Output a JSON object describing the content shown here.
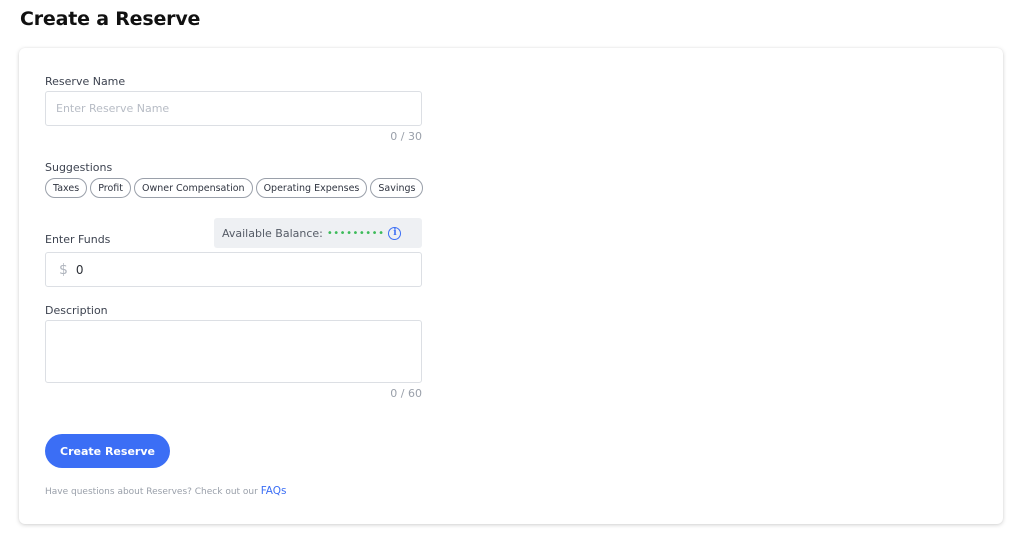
{
  "page": {
    "title": "Create a Reserve"
  },
  "form": {
    "reserve_name": {
      "label": "Reserve Name",
      "placeholder": "Enter Reserve Name",
      "value": "",
      "counter": "0 / 30"
    },
    "suggestions": {
      "label": "Suggestions",
      "items": [
        "Taxes",
        "Profit",
        "Owner Compensation",
        "Operating Expenses",
        "Savings"
      ]
    },
    "funds": {
      "label": "Enter Funds",
      "currency_symbol": "$",
      "value": "0",
      "available_balance_label": "Available Balance:",
      "available_balance_value": "•••••••••",
      "available_balance_color": "#3dbb5a",
      "info_icon": "info-icon"
    },
    "description": {
      "label": "Description",
      "value": "",
      "counter": "0 / 60"
    },
    "submit_label": "Create Reserve",
    "accent_color": "#3b6ef5"
  },
  "footer": {
    "text": "Have questions about Reserves? Check out our",
    "link_text": "FAQs"
  }
}
